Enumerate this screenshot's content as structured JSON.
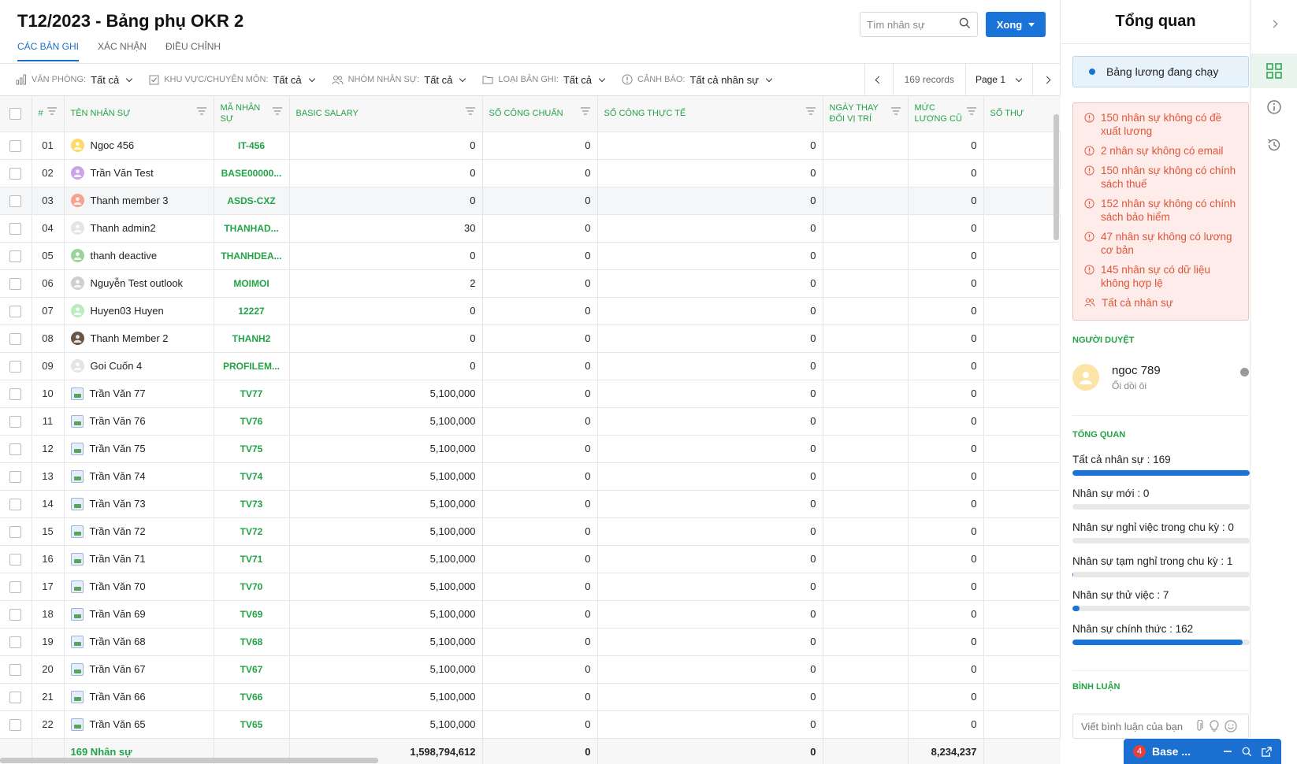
{
  "header": {
    "title": "T12/2023 - Bảng phụ OKR 2",
    "tabs": [
      {
        "label": "CÁC BẢN GHI",
        "active": true
      },
      {
        "label": "XÁC NHẬN",
        "active": false
      },
      {
        "label": "ĐIỀU CHỈNH",
        "active": false
      }
    ],
    "search_placeholder": "Tìm nhân sự",
    "done_label": "Xong"
  },
  "filters": [
    {
      "label": "VĂN PHÒNG:",
      "value": "Tất cả",
      "icon": "chart-icon"
    },
    {
      "label": "KHU VỰC/CHUYÊN MÔN:",
      "value": "Tất cả",
      "icon": "checkbox-icon"
    },
    {
      "label": "NHÓM NHÂN SỰ:",
      "value": "Tất cả",
      "icon": "users-icon"
    },
    {
      "label": "LOẠI BẢN GHI:",
      "value": "Tất cả",
      "icon": "folder-icon"
    },
    {
      "label": "CẢNH BÁO:",
      "value": "Tất cả nhân sự",
      "icon": "alert-icon"
    }
  ],
  "pager": {
    "records": "169 records",
    "page": "Page 1"
  },
  "table": {
    "columns": [
      "#",
      "TÊN NHÂN SỰ",
      "MÃ NHÂN SỰ",
      "BASIC SALARY",
      "SỐ CÔNG CHUẨN",
      "SỐ CÔNG THỰC TẾ",
      "NGÀY THAY ĐỔI VỊ TRÍ",
      "MỨC LƯƠNG CŨ",
      "SỐ THỰ"
    ],
    "rows": [
      {
        "no": "01",
        "name": "Ngoc 456",
        "code": "IT-456",
        "basic": "0",
        "std": "0",
        "actual": "0",
        "date": "",
        "old": "0",
        "avatar": "yellow"
      },
      {
        "no": "02",
        "name": "Trần Văn Test",
        "code": "BASE00000...",
        "basic": "0",
        "std": "0",
        "actual": "0",
        "date": "",
        "old": "0",
        "avatar": "purple"
      },
      {
        "no": "03",
        "name": "Thanh member 3",
        "code": "ASDS-CXZ",
        "basic": "0",
        "std": "0",
        "actual": "0",
        "date": "",
        "old": "0",
        "avatar": "salmon"
      },
      {
        "no": "04",
        "name": "Thanh admin2",
        "code": "THANHAD...",
        "basic": "30",
        "std": "0",
        "actual": "0",
        "date": "",
        "old": "0",
        "avatar": "lightgray"
      },
      {
        "no": "05",
        "name": "thanh deactive",
        "code": "THANHDEA...",
        "basic": "0",
        "std": "0",
        "actual": "0",
        "date": "",
        "old": "0",
        "avatar": "green"
      },
      {
        "no": "06",
        "name": "Nguyễn Test outlook",
        "code": "MOIMOI",
        "basic": "2",
        "std": "0",
        "actual": "0",
        "date": "",
        "old": "0",
        "avatar": "gray"
      },
      {
        "no": "07",
        "name": "Huyen03 Huyen",
        "code": "12227",
        "basic": "0",
        "std": "0",
        "actual": "0",
        "date": "",
        "old": "0",
        "avatar": "lightgreen"
      },
      {
        "no": "08",
        "name": "Thanh Member 2",
        "code": "THANH2",
        "basic": "0",
        "std": "0",
        "actual": "0",
        "date": "",
        "old": "0",
        "avatar": "photo"
      },
      {
        "no": "09",
        "name": "Goi Cuốn 4",
        "code": "PROFILEM...",
        "basic": "0",
        "std": "0",
        "actual": "0",
        "date": "",
        "old": "0",
        "avatar": "lightgray"
      },
      {
        "no": "10",
        "name": "Trần Văn 77",
        "code": "TV77",
        "basic": "5,100,000",
        "std": "0",
        "actual": "0",
        "date": "",
        "old": "0",
        "avatar": "img"
      },
      {
        "no": "11",
        "name": "Trần Văn 76",
        "code": "TV76",
        "basic": "5,100,000",
        "std": "0",
        "actual": "0",
        "date": "",
        "old": "0",
        "avatar": "img"
      },
      {
        "no": "12",
        "name": "Trần Văn 75",
        "code": "TV75",
        "basic": "5,100,000",
        "std": "0",
        "actual": "0",
        "date": "",
        "old": "0",
        "avatar": "img"
      },
      {
        "no": "13",
        "name": "Trần Văn 74",
        "code": "TV74",
        "basic": "5,100,000",
        "std": "0",
        "actual": "0",
        "date": "",
        "old": "0",
        "avatar": "img"
      },
      {
        "no": "14",
        "name": "Trần Văn 73",
        "code": "TV73",
        "basic": "5,100,000",
        "std": "0",
        "actual": "0",
        "date": "",
        "old": "0",
        "avatar": "img"
      },
      {
        "no": "15",
        "name": "Trần Văn 72",
        "code": "TV72",
        "basic": "5,100,000",
        "std": "0",
        "actual": "0",
        "date": "",
        "old": "0",
        "avatar": "img"
      },
      {
        "no": "16",
        "name": "Trần Văn 71",
        "code": "TV71",
        "basic": "5,100,000",
        "std": "0",
        "actual": "0",
        "date": "",
        "old": "0",
        "avatar": "img"
      },
      {
        "no": "17",
        "name": "Trần Văn 70",
        "code": "TV70",
        "basic": "5,100,000",
        "std": "0",
        "actual": "0",
        "date": "",
        "old": "0",
        "avatar": "img"
      },
      {
        "no": "18",
        "name": "Trần Văn 69",
        "code": "TV69",
        "basic": "5,100,000",
        "std": "0",
        "actual": "0",
        "date": "",
        "old": "0",
        "avatar": "img"
      },
      {
        "no": "19",
        "name": "Trần Văn 68",
        "code": "TV68",
        "basic": "5,100,000",
        "std": "0",
        "actual": "0",
        "date": "",
        "old": "0",
        "avatar": "img"
      },
      {
        "no": "20",
        "name": "Trần Văn 67",
        "code": "TV67",
        "basic": "5,100,000",
        "std": "0",
        "actual": "0",
        "date": "",
        "old": "0",
        "avatar": "img"
      },
      {
        "no": "21",
        "name": "Trần Văn 66",
        "code": "TV66",
        "basic": "5,100,000",
        "std": "0",
        "actual": "0",
        "date": "",
        "old": "0",
        "avatar": "img"
      },
      {
        "no": "22",
        "name": "Trần Văn 65",
        "code": "TV65",
        "basic": "5,100,000",
        "std": "0",
        "actual": "0",
        "date": "",
        "old": "0",
        "avatar": "img"
      }
    ],
    "footer": {
      "label": "169 Nhân sự",
      "basic": "1,598,794,612",
      "std": "0",
      "actual": "0",
      "old": "8,234,237"
    }
  },
  "panel": {
    "title": "Tổng quan",
    "running": "Bảng lương đang chạy",
    "warnings": [
      "150 nhân sự không có đề xuất lương",
      "2 nhân sự không có email",
      "150 nhân sự không có chính sách thuế",
      "152 nhân sự không có chính sách bảo hiểm",
      "47 nhân sự không có lương cơ bản",
      "145 nhân sự có dữ liệu không hợp lệ"
    ],
    "all_staff_link": "Tất cả nhân sự",
    "approver_heading": "NGƯỜI DUYỆT",
    "approver": {
      "name": "ngoc 789",
      "sub": "Ối dồi ôi"
    },
    "overview_heading": "TỔNG QUAN",
    "stats": [
      {
        "label": "Tất cả nhân sự : 169",
        "fraction": 1.0
      },
      {
        "label": "Nhân sự mới : 0",
        "fraction": 0.0
      },
      {
        "label": "Nhân sự nghỉ việc trong chu kỳ : 0",
        "fraction": 0.0
      },
      {
        "label": "Nhân sự tạm nghỉ trong chu kỳ : 1",
        "fraction": 0.006
      },
      {
        "label": "Nhân sự thử việc : 7",
        "fraction": 0.041
      },
      {
        "label": "Nhân sự chính thức : 162",
        "fraction": 0.959
      }
    ],
    "comment_heading": "BÌNH LUẬN",
    "comment_placeholder": "Viết bình luận của bạn"
  },
  "chat": {
    "badge": "4",
    "title": "Base ..."
  },
  "colors": {
    "accent": "#1a73d9",
    "green": "#23a347",
    "warning": "#e0553a"
  }
}
